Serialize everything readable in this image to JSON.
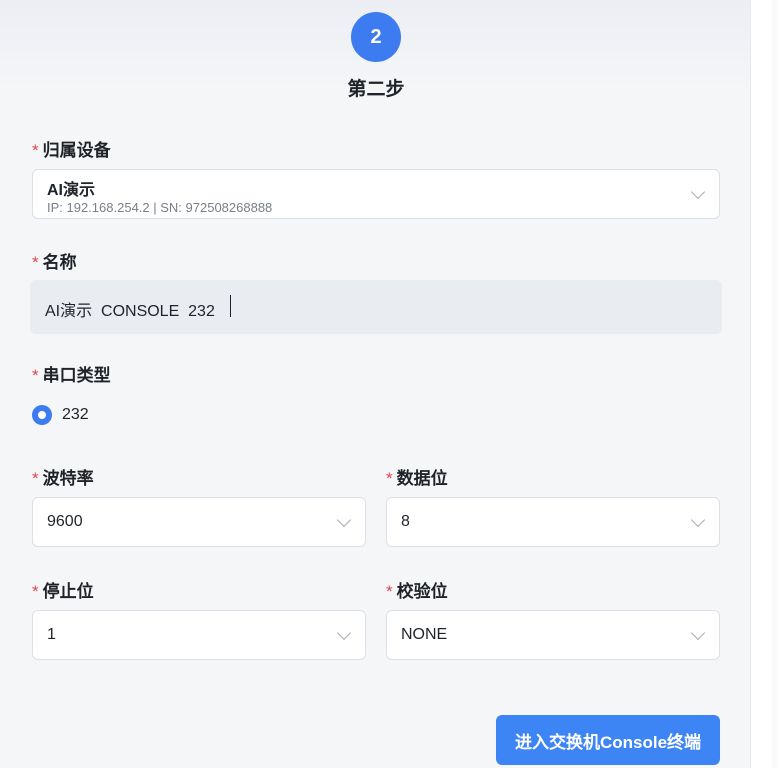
{
  "step": {
    "number": "2",
    "title": "第二步"
  },
  "form": {
    "required_mark": "*",
    "device": {
      "label": "归属设备",
      "name": "AI演示",
      "detail": "IP: 192.168.254.2 | SN: 972508268888"
    },
    "name": {
      "label": "名称",
      "value": "AI演示  CONSOLE  232"
    },
    "serial_type": {
      "label": "串口类型",
      "option": "232",
      "selected": true
    },
    "baud_rate": {
      "label": "波特率",
      "value": "9600"
    },
    "data_bits": {
      "label": "数据位",
      "value": "8"
    },
    "stop_bits": {
      "label": "停止位",
      "value": "1"
    },
    "parity": {
      "label": "校验位",
      "value": "NONE"
    }
  },
  "actions": {
    "enter_console": "进入交换机Console终端"
  },
  "colors": {
    "primary": "#3c7cf0",
    "required": "#e0474a"
  }
}
